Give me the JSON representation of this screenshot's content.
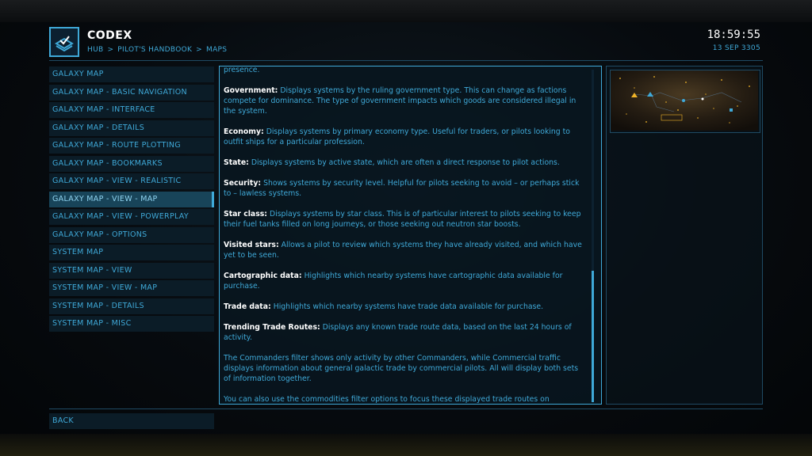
{
  "header": {
    "title": "CODEX",
    "breadcrumb": [
      "HUB",
      "PILOT'S HANDBOOK",
      "MAPS"
    ],
    "breadcrumb_sep": ">",
    "time": "18:59:55",
    "date": "13 SEP 3305"
  },
  "sidebar": {
    "items": [
      {
        "label": "GALAXY MAP"
      },
      {
        "label": "GALAXY MAP - BASIC NAVIGATION"
      },
      {
        "label": "GALAXY MAP - INTERFACE"
      },
      {
        "label": "GALAXY MAP - DETAILS"
      },
      {
        "label": "GALAXY MAP - ROUTE PLOTTING"
      },
      {
        "label": "GALAXY MAP - BOOKMARKS"
      },
      {
        "label": "GALAXY MAP - VIEW - REALISTIC"
      },
      {
        "label": "GALAXY MAP - VIEW - MAP",
        "active": true
      },
      {
        "label": "GALAXY MAP - VIEW - POWERPLAY"
      },
      {
        "label": "GALAXY MAP - OPTIONS"
      },
      {
        "label": "SYSTEM MAP"
      },
      {
        "label": "SYSTEM MAP - VIEW"
      },
      {
        "label": "SYSTEM MAP - VIEW - MAP"
      },
      {
        "label": "SYSTEM MAP - DETAILS"
      },
      {
        "label": "SYSTEM MAP - MISC"
      }
    ]
  },
  "content": {
    "cut_text": "presence.",
    "paragraphs": [
      {
        "term": "Government:",
        "text": " Displays systems by the ruling government type. This can change as factions compete for dominance. The type of government impacts which goods are considered illegal in the system."
      },
      {
        "term": "Economy:",
        "text": " Displays systems by primary economy type. Useful for traders, or pilots looking to outfit ships for a particular profession."
      },
      {
        "term": "State:",
        "text": " Displays systems by active state, which are often a direct response to pilot actions."
      },
      {
        "term": "Security:",
        "text": " Shows systems by security level. Helpful for pilots seeking to avoid – or perhaps stick to – lawless systems."
      },
      {
        "term": "Star class:",
        "text": " Displays systems by star class. This is of particular interest to pilots seeking to keep their fuel tanks filled on long journeys, or those seeking out neutron star boosts."
      },
      {
        "term": "Visited stars:",
        "text": " Allows a pilot to review which systems they have already visited, and which have yet to be seen."
      },
      {
        "term": "Cartographic data:",
        "text": " Highlights which nearby systems have cartographic data available for purchase."
      },
      {
        "term": "Trade data:",
        "text": " Highlights which nearby systems have trade data available for purchase."
      },
      {
        "term": "Trending Trade Routes:",
        "text": " Displays any known trade route data, based on the last 24 hours of activity."
      },
      {
        "term": "",
        "text": "The Commanders filter shows only activity by other Commanders, while Commercial traffic displays information about general galactic trade by commercial pilots. All will display both sets of information together."
      },
      {
        "term": "",
        "text": "You can also use the commodities filter options to focus these displayed trade routes on commodity types or individual items."
      }
    ]
  },
  "footer": {
    "back_label": "BACK"
  },
  "colors": {
    "accent": "#3fa9d8",
    "active_bg": "#184459",
    "item_bg": "#0b1c27",
    "white": "#ffffff",
    "map_star": "#f0b429"
  },
  "icons": {
    "header_logo": "codex-book-icon"
  }
}
